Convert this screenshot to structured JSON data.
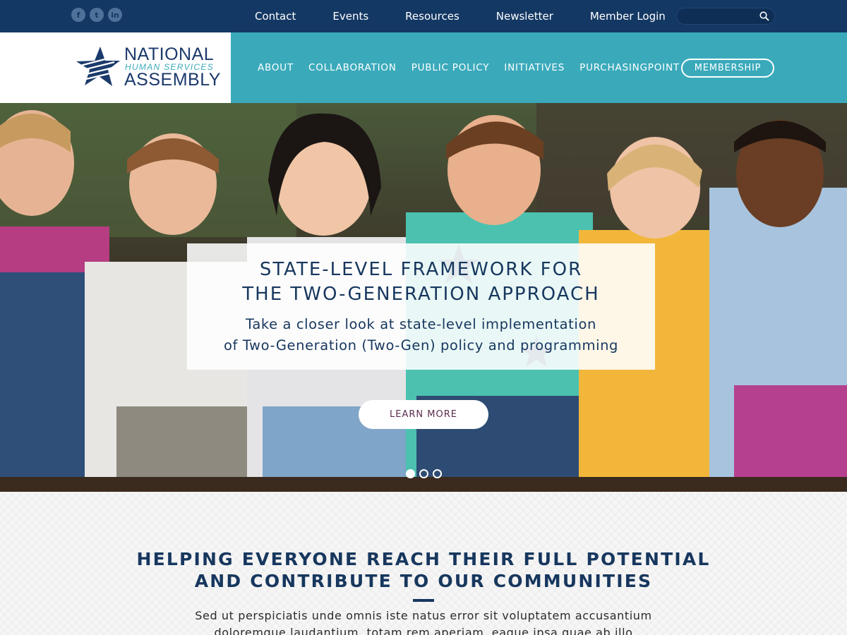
{
  "topbar": {
    "social": [
      {
        "name": "facebook-icon",
        "glyph": "f"
      },
      {
        "name": "twitter-icon",
        "glyph": "t"
      },
      {
        "name": "linkedin-icon",
        "glyph": "in"
      }
    ],
    "links": [
      "Contact",
      "Events",
      "Resources",
      "Newsletter",
      "Member Login"
    ],
    "search": {
      "placeholder": "",
      "icon": "search-icon"
    },
    "background": "#143864"
  },
  "logo": {
    "line1": "NATIONAL",
    "line2": "HUMAN SERVICES",
    "line3": "ASSEMBLY",
    "icon": "star-logo-icon"
  },
  "nav": {
    "items": [
      "ABOUT",
      "COLLABORATION",
      "PUBLIC POLICY",
      "INITIATIVES",
      "PURCHASINGPOINT"
    ],
    "membership_label": "MEMBERSHIP",
    "background": "#3aaabb"
  },
  "hero": {
    "title_line1": "STATE-LEVEL FRAMEWORK FOR",
    "title_line2": "THE TWO-GENERATION APPROACH",
    "subtitle_line1": "Take a closer look at state-level implementation",
    "subtitle_line2": "of Two-Generation (Two-Gen) policy and programming",
    "cta_label": "LEARN MORE",
    "slides": 3,
    "active_slide": 1
  },
  "intro": {
    "title_line1": "HELPING EVERYONE REACH THEIR FULL POTENTIAL",
    "title_line2": "AND CONTRIBUTE TO OUR COMMUNITIES",
    "body_line1": "Sed ut perspiciatis unde omnis iste natus error sit voluptatem accusantium",
    "body_line2": "doloremque laudantium, totam rem aperiam, eaque ipsa quae ab illo"
  },
  "colors": {
    "navy": "#17375e",
    "teal": "#3aaabb",
    "cta_text": "#5b2b4d"
  }
}
